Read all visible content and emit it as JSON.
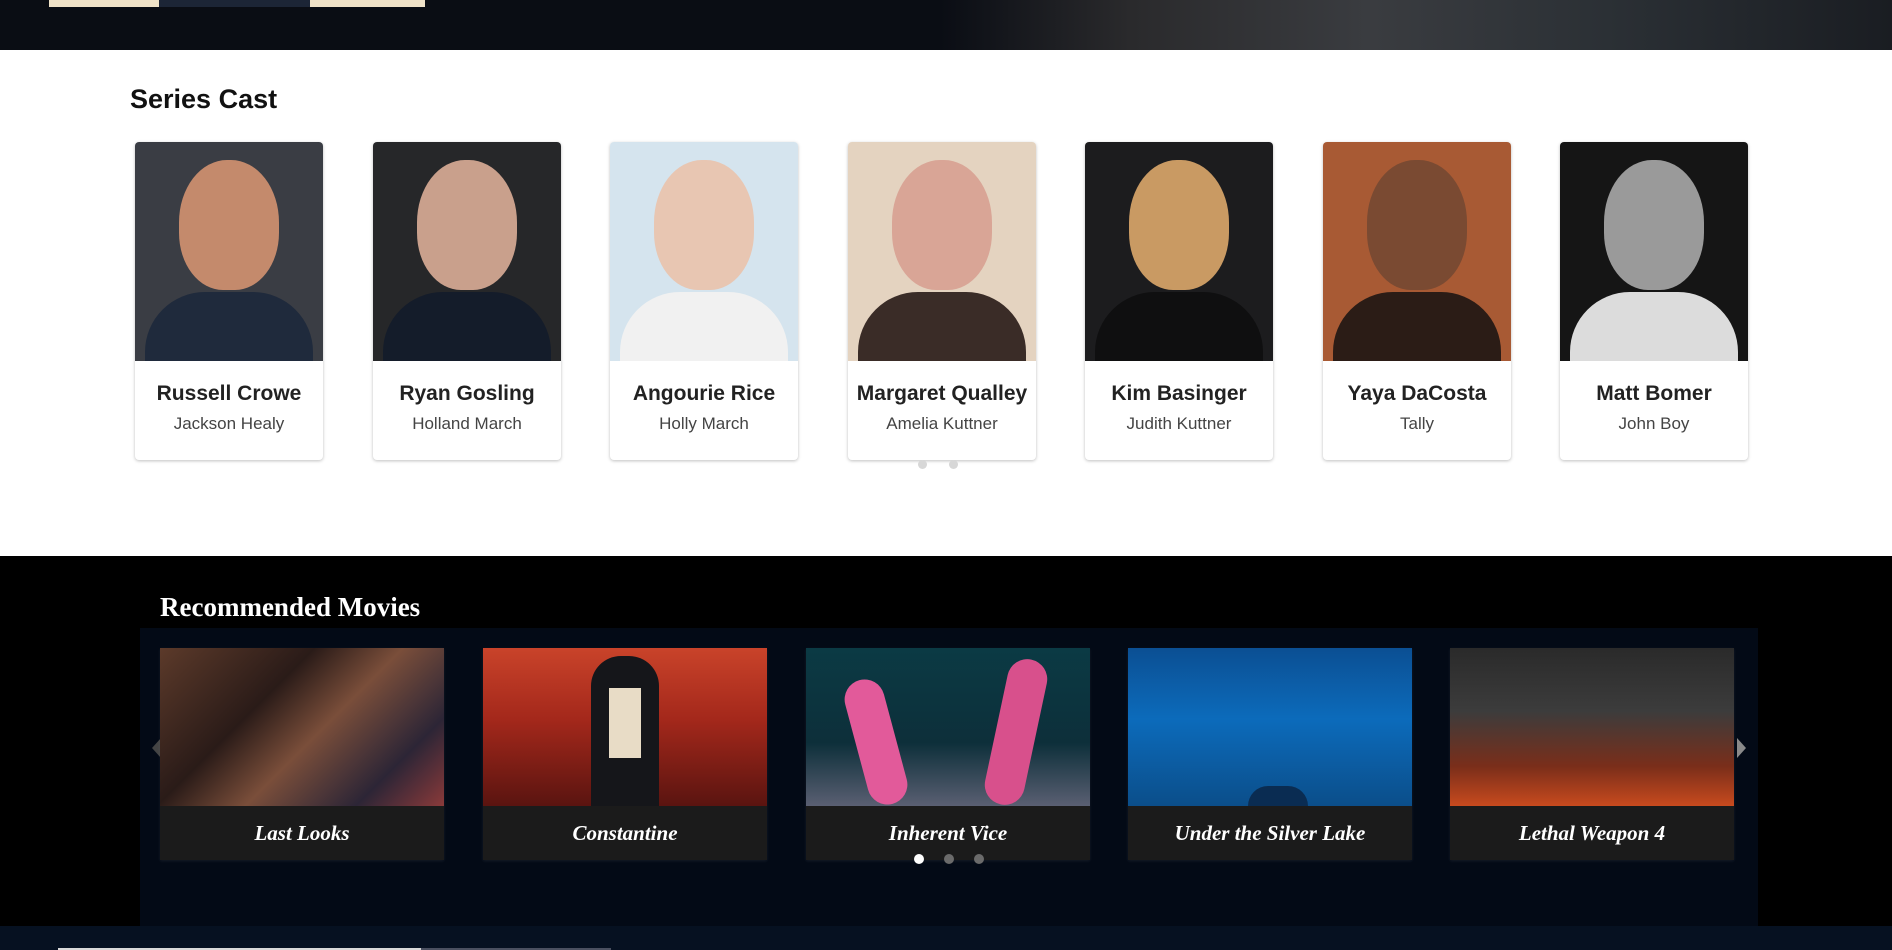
{
  "cast": {
    "title": "Series Cast",
    "members": [
      {
        "name": "Russell Crowe",
        "role": "Jackson Healy"
      },
      {
        "name": "Ryan Gosling",
        "role": "Holland March"
      },
      {
        "name": "Angourie Rice",
        "role": "Holly March"
      },
      {
        "name": "Margaret Qualley",
        "role": "Amelia Kuttner"
      },
      {
        "name": "Kim Basinger",
        "role": "Judith Kuttner"
      },
      {
        "name": "Yaya DaCosta",
        "role": "Tally"
      },
      {
        "name": "Matt Bomer",
        "role": "John Boy"
      }
    ]
  },
  "recommended": {
    "title": "Recommended Movies",
    "movies": [
      {
        "title": "Last Looks"
      },
      {
        "title": "Constantine"
      },
      {
        "title": "Inherent Vice"
      },
      {
        "title": "Under the Silver Lake"
      },
      {
        "title": "Lethal Weapon 4"
      }
    ],
    "active_page": 1,
    "page_count": 3
  },
  "colors": {
    "page_bg": "#ffffff",
    "rec_bg": "#000000",
    "rec_inner_bg": "#030a16",
    "caption_bg": "#1b1b1b"
  }
}
